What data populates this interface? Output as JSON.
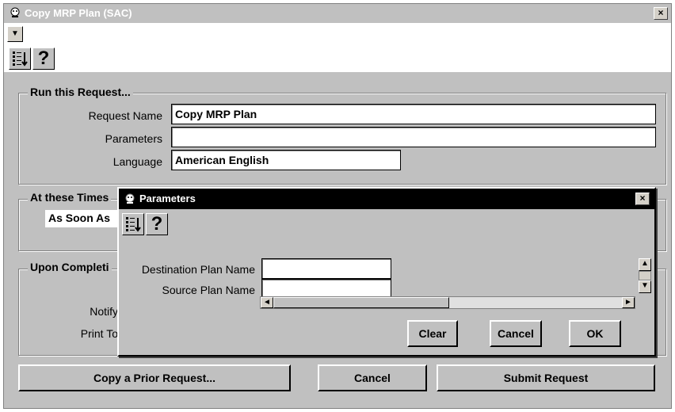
{
  "window": {
    "title": "Copy MRP Plan (SAC)",
    "close_glyph": "×"
  },
  "menu": {
    "dropdown_glyph": "▼"
  },
  "toolbar": {
    "help_glyph": "?"
  },
  "run_request": {
    "legend": "Run this Request...",
    "request_name_label": "Request Name",
    "request_name_value": "Copy MRP Plan",
    "parameters_label": "Parameters",
    "parameters_value": "",
    "language_label": "Language",
    "language_value": "American English"
  },
  "times": {
    "legend": "At these Times",
    "value": "As Soon As"
  },
  "completion": {
    "legend": "Upon Completi",
    "notify_label": "Notify",
    "print_to_label": "Print To"
  },
  "buttons": {
    "copy_prior": "Copy a Prior Request...",
    "cancel": "Cancel",
    "submit": "Submit Request"
  },
  "dialog": {
    "title": "Parameters",
    "close_glyph": "×",
    "help_glyph": "?",
    "destination_label": "Destination Plan Name",
    "destination_value": "",
    "source_label": "Source Plan Name",
    "source_value": "",
    "clear": "Clear",
    "cancel": "Cancel",
    "ok": "OK",
    "scroll_up": "▲",
    "scroll_down": "▼",
    "scroll_left": "◄",
    "scroll_right": "►"
  }
}
